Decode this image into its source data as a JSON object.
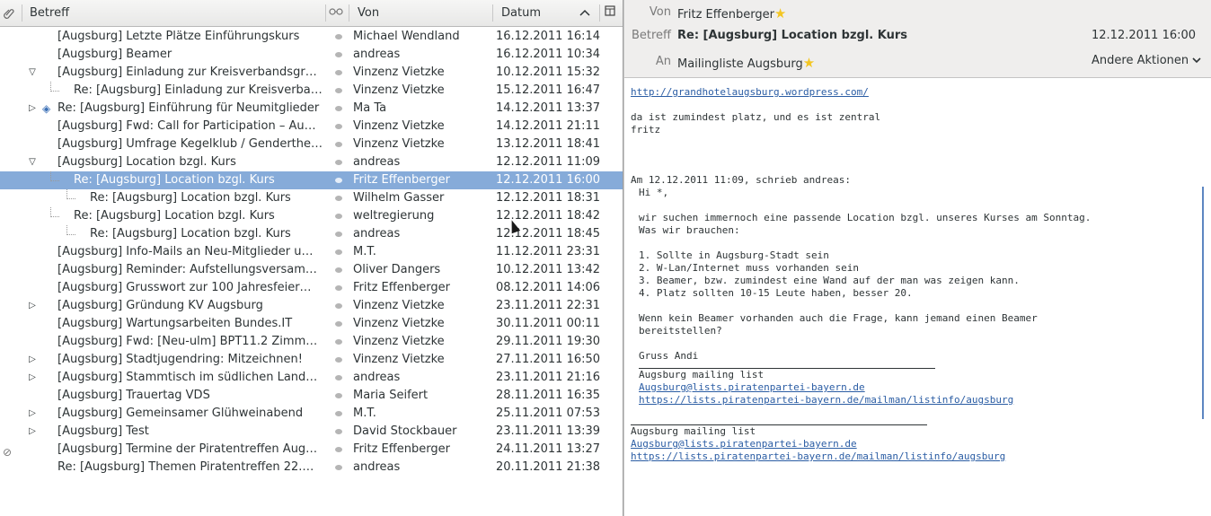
{
  "list": {
    "columns": {
      "attachment_icon": "paperclip-icon",
      "subject": "Betreff",
      "thread_icon": "glasses-icon",
      "from": "Von",
      "date": "Datum",
      "picker_icon": "column-picker-icon"
    },
    "rows": [
      {
        "subject": "[Augsburg] Letzte Plätze Einführungskurs",
        "from": "Michael Wendland",
        "date": "16.12.2011 16:14",
        "indent": 0
      },
      {
        "subject": "[Augsburg] Beamer",
        "from": "andreas",
        "date": "16.12.2011 10:34",
        "indent": 0
      },
      {
        "subject": "[Augsburg] Einladung zur Kreisverbandsgrü…",
        "from": "Vinzenz Vietzke",
        "date": "10.12.2011 15:32",
        "indent": 0,
        "twisty": "expanded"
      },
      {
        "subject": "Re: [Augsburg] Einladung zur Kreisverba…",
        "from": "Vinzenz Vietzke",
        "date": "15.12.2011 16:47",
        "indent": 1
      },
      {
        "subject": "Re: [Augsburg] Einführung für Neumitglieder",
        "from": "Ma Ta",
        "date": "14.12.2011 13:37",
        "indent": 0,
        "twisty": "collapsed",
        "special": true
      },
      {
        "subject": "[Augsburg] Fwd: Call for Participation – Au…",
        "from": "Vinzenz Vietzke",
        "date": "14.12.2011 21:11",
        "indent": 0
      },
      {
        "subject": "[Augsburg] Umfrage Kegelklub / Genderthe…",
        "from": "Vinzenz Vietzke",
        "date": "13.12.2011 18:41",
        "indent": 0
      },
      {
        "subject": "[Augsburg] Location bzgl. Kurs",
        "from": "andreas",
        "date": "12.12.2011 11:09",
        "indent": 0,
        "twisty": "expanded"
      },
      {
        "subject": "Re: [Augsburg] Location bzgl. Kurs",
        "from": "Fritz Effenberger",
        "date": "12.12.2011 16:00",
        "indent": 1,
        "selected": true
      },
      {
        "subject": "Re: [Augsburg] Location bzgl. Kurs",
        "from": "Wilhelm Gasser",
        "date": "12.12.2011 18:31",
        "indent": 2
      },
      {
        "subject": "Re: [Augsburg] Location bzgl. Kurs",
        "from": "weltregierung",
        "date": "12.12.2011 18:42",
        "indent": 1
      },
      {
        "subject": "Re: [Augsburg] Location bzgl. Kurs",
        "from": "andreas",
        "date": "12.12.2011 18:45",
        "indent": 2
      },
      {
        "subject": "[Augsburg] Info-Mails an Neu-Mitglieder u…",
        "from": "M.T.",
        "date": "11.12.2011 23:31",
        "indent": 0
      },
      {
        "subject": "[Augsburg] Reminder: Aufstellungsversam…",
        "from": "Oliver Dangers",
        "date": "10.12.2011 13:42",
        "indent": 0
      },
      {
        "subject": "[Augsburg] Grusswort zur 100 Jahresfeier…",
        "from": "Fritz Effenberger",
        "date": "08.12.2011 14:06",
        "indent": 0
      },
      {
        "subject": "[Augsburg] Gründung KV Augsburg",
        "from": "Vinzenz Vietzke",
        "date": "23.11.2011 22:31",
        "indent": 0,
        "twisty": "collapsed"
      },
      {
        "subject": "[Augsburg] Wartungsarbeiten Bundes.IT",
        "from": "Vinzenz Vietzke",
        "date": "30.11.2011 00:11",
        "indent": 0
      },
      {
        "subject": "[Augsburg] Fwd: [Neu-ulm] BPT11.2 Zimm…",
        "from": "Vinzenz Vietzke",
        "date": "29.11.2011 19:30",
        "indent": 0
      },
      {
        "subject": "[Augsburg] Stadtjugendring: Mitzeichnen!",
        "from": "Vinzenz Vietzke",
        "date": "27.11.2011 16:50",
        "indent": 0,
        "twisty": "collapsed"
      },
      {
        "subject": "[Augsburg] Stammtisch im südlichen Landkr…",
        "from": "andreas",
        "date": "23.11.2011 21:16",
        "indent": 0,
        "twisty": "collapsed"
      },
      {
        "subject": "[Augsburg] Trauertag VDS",
        "from": "Maria Seifert",
        "date": "28.11.2011 16:35",
        "indent": 0
      },
      {
        "subject": "[Augsburg] Gemeinsamer Glühweinabend",
        "from": "M.T.",
        "date": "25.11.2011 07:53",
        "indent": 0,
        "twisty": "collapsed"
      },
      {
        "subject": "[Augsburg] Test",
        "from": "David Stockbauer",
        "date": "23.11.2011 13:39",
        "indent": 0,
        "twisty": "collapsed"
      },
      {
        "subject": "[Augsburg] Termine der Piratentreffen Aug…",
        "from": "Fritz Effenberger",
        "date": "24.11.2011 13:27",
        "indent": 0,
        "attachment": true
      },
      {
        "subject": "Re: [Augsburg] Themen Piratentreffen 22.…",
        "from": "andreas",
        "date": "20.11.2011 21:38",
        "indent": 0
      }
    ]
  },
  "message": {
    "from_label": "Von",
    "from_value": "Fritz Effenberger",
    "subject_label": "Betreff",
    "subject_value": "Re: [Augsburg] Location bzgl. Kurs",
    "date_value": "12.12.2011 16:00",
    "to_label": "An",
    "to_value": "Mailingliste Augsburg",
    "other_actions": "Andere Aktionen",
    "body": {
      "link": "http://grandhotelaugsburg.wordpress.com/",
      "lines": [
        "da ist zumindest platz, und es ist zentral",
        "fritz"
      ],
      "quote_intro": "Am 12.12.2011 11:09, schrieb andreas:",
      "quote_lines": [
        "Hi *,",
        "",
        "wir suchen immernoch eine passende Location bzgl. unseres Kurses am Sonntag.",
        "Was wir brauchen:",
        "",
        "1. Sollte in Augsburg-Stadt sein",
        "2. W-Lan/Internet muss vorhanden sein",
        "3. Beamer, bzw. zumindest eine Wand auf der man was zeigen kann.",
        "4. Platz sollten 10-15 Leute haben, besser 20.",
        "",
        "Wenn kein Beamer vorhanden auch die Frage, kann jemand einen Beamer",
        "bereitstellen?",
        "",
        "Gruss Andi"
      ],
      "quote_sig_title": "Augsburg mailing list",
      "quote_sig_email": "Augsburg@lists.piratenpartei-bayern.de",
      "quote_sig_url": "https://lists.piratenpartei-bayern.de/mailman/listinfo/augsburg",
      "sig_title": "Augsburg mailing list",
      "sig_email": "Augsburg@lists.piratenpartei-bayern.de",
      "sig_url": "https://lists.piratenpartei-bayern.de/mailman/listinfo/augsburg"
    }
  },
  "colors": {
    "selection": "#86abd9",
    "link": "#2b5da4",
    "star": "#f3c623",
    "quote_bar": "#5d86c2"
  }
}
